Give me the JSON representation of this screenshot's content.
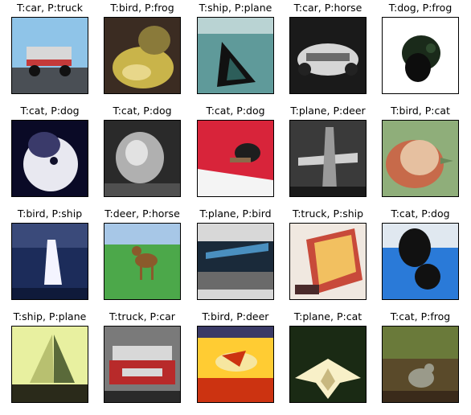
{
  "figure": {
    "panels": [
      {
        "title": "T:car, P:truck",
        "true_label": "car",
        "pred_label": "truck",
        "scene": "car",
        "colors": [
          "#8fc4e8",
          "#4a4f55",
          "#d8d8d8",
          "#c43a3a"
        ]
      },
      {
        "title": "T:bird, P:frog",
        "true_label": "bird",
        "pred_label": "frog",
        "scene": "bird_yellow",
        "colors": [
          "#3b2c22",
          "#c9b44a",
          "#8a7a3a",
          "#e8d78a"
        ]
      },
      {
        "title": "T:ship, P:plane",
        "true_label": "ship",
        "pred_label": "plane",
        "scene": "boat_water",
        "colors": [
          "#5f9a9a",
          "#2d5e5a",
          "#111111",
          "#b9d3d3"
        ]
      },
      {
        "title": "T:car, P:horse",
        "true_label": "car",
        "pred_label": "horse",
        "scene": "racecar",
        "colors": [
          "#1a1a1a",
          "#d6d6d6",
          "#6a6a6a",
          "#a0a0a0"
        ]
      },
      {
        "title": "T:dog, P:frog",
        "true_label": "dog",
        "pred_label": "frog",
        "scene": "dark_blob",
        "colors": [
          "#ffffff",
          "#1a2a1a",
          "#2e4a2e",
          "#0d0d0d"
        ]
      },
      {
        "title": "T:cat, P:dog",
        "true_label": "cat",
        "pred_label": "dog",
        "scene": "cat_bw",
        "colors": [
          "#0a0a26",
          "#e8e8f0",
          "#3a3a6a",
          "#10102a"
        ]
      },
      {
        "title": "T:cat, P:dog",
        "true_label": "cat",
        "pred_label": "dog",
        "scene": "cat_grey",
        "colors": [
          "#2a2a2a",
          "#b0b0b0",
          "#e2e2e2",
          "#505050"
        ]
      },
      {
        "title": "T:cat, P:dog",
        "true_label": "cat",
        "pred_label": "dog",
        "scene": "cat_red",
        "colors": [
          "#d8243a",
          "#f4f4f4",
          "#1e1e1e",
          "#8a6a4a"
        ]
      },
      {
        "title": "T:plane, P:deer",
        "true_label": "plane",
        "pred_label": "deer",
        "scene": "plane_grey",
        "colors": [
          "#3a3a3a",
          "#9a9a9a",
          "#d0d0d0",
          "#1a1a1a"
        ]
      },
      {
        "title": "T:bird, P:cat",
        "true_label": "bird",
        "pred_label": "cat",
        "scene": "bird_orange",
        "colors": [
          "#8fae7a",
          "#c76a4a",
          "#e6c0a0",
          "#6b8a5a"
        ]
      },
      {
        "title": "T:bird, P:ship",
        "true_label": "bird",
        "pred_label": "ship",
        "scene": "white_bird_water",
        "colors": [
          "#1c2c5a",
          "#f4f4ff",
          "#3a4a7a",
          "#0f1a3a"
        ]
      },
      {
        "title": "T:deer, P:horse",
        "true_label": "deer",
        "pred_label": "horse",
        "scene": "deer_field",
        "colors": [
          "#4ca84a",
          "#8b5a2b",
          "#a7c7e7",
          "#2e7a2e"
        ]
      },
      {
        "title": "T:plane, P:bird",
        "true_label": "plane",
        "pred_label": "bird",
        "scene": "plane_crowd",
        "colors": [
          "#1a2a3a",
          "#4a8fbf",
          "#d8d8d8",
          "#6a6a6a"
        ]
      },
      {
        "title": "T:truck, P:ship",
        "true_label": "truck",
        "pred_label": "ship",
        "scene": "truck_red",
        "colors": [
          "#f0e8e0",
          "#c84a3a",
          "#f2c060",
          "#4a2a2a"
        ]
      },
      {
        "title": "T:cat, P:dog",
        "true_label": "cat",
        "pred_label": "dog",
        "scene": "cat_blue",
        "colors": [
          "#2a7ad8",
          "#111111",
          "#e0e8f0",
          "#4a3a2a"
        ]
      },
      {
        "title": "T:ship, P:plane",
        "true_label": "ship",
        "pred_label": "plane",
        "scene": "sailboat",
        "colors": [
          "#e8f0a0",
          "#5a6a3a",
          "#2a2a1a",
          "#b8c070"
        ]
      },
      {
        "title": "T:truck, P:car",
        "true_label": "truck",
        "pred_label": "car",
        "scene": "pickup",
        "colors": [
          "#d8d8d8",
          "#b82a2a",
          "#2a2a2a",
          "#7a7a7a"
        ]
      },
      {
        "title": "T:bird, P:deer",
        "true_label": "bird",
        "pred_label": "deer",
        "scene": "bird_sunset",
        "colors": [
          "#ffcc33",
          "#cc3311",
          "#f6e6a0",
          "#3a3a66"
        ]
      },
      {
        "title": "T:plane, P:cat",
        "true_label": "plane",
        "pred_label": "cat",
        "scene": "stealth_plane",
        "colors": [
          "#1a2a14",
          "#f8f0c8",
          "#3a4a2a",
          "#c8b880"
        ]
      },
      {
        "title": "T:cat, P:frog",
        "true_label": "cat",
        "pred_label": "frog",
        "scene": "cat_ground",
        "colors": [
          "#5a4a2a",
          "#6a7a3a",
          "#9a9a8a",
          "#3a2a1a"
        ]
      }
    ]
  }
}
